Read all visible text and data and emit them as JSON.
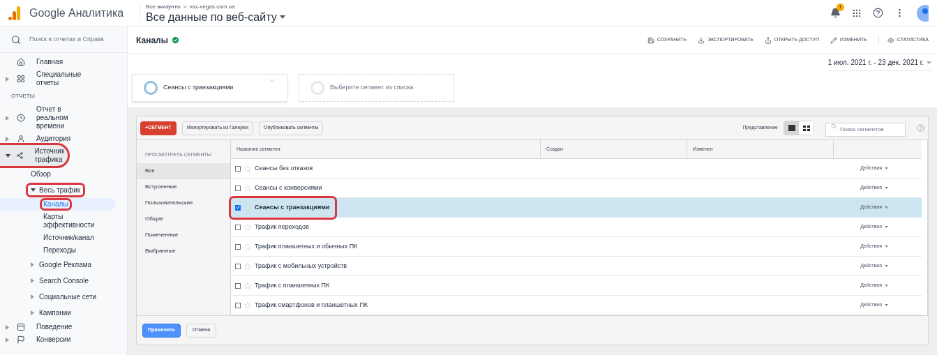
{
  "header": {
    "product": "Google Аналитика",
    "breadcrumb": [
      "Все аккаунты",
      ">",
      "vaz-vegas.com.ua"
    ],
    "view_title": "Все данные по веб-сайту",
    "notifications": "1"
  },
  "sidebar": {
    "search_placeholder": "Поиск в отчетах и Справк",
    "items": [
      {
        "kind": "item",
        "label": "Главная",
        "expandable": false,
        "expanded": false,
        "highlighted": false
      },
      {
        "kind": "item",
        "label": "Специальные отчеты",
        "expandable": true,
        "expanded": false,
        "highlighted": false
      },
      {
        "kind": "section",
        "label": "ОТЧЕТЫ"
      },
      {
        "kind": "item",
        "label": "Отчет в реальном времени",
        "expandable": true,
        "expanded": false,
        "highlighted": false
      },
      {
        "kind": "item",
        "label": "Аудитория",
        "expandable": true,
        "expanded": false,
        "highlighted": false
      },
      {
        "kind": "item",
        "label": "Источник трафика",
        "expandable": true,
        "expanded": true,
        "highlighted": true,
        "children": [
          {
            "label": "Обзор",
            "expandable": false,
            "expanded": false,
            "highlighted": false
          },
          {
            "label": "Весь трафик",
            "expandable": true,
            "expanded": true,
            "highlighted": true,
            "children": [
              {
                "label": "Каналы",
                "selected": true,
                "highlighted": true
              },
              {
                "label": "Карты эффективности",
                "selected": false,
                "highlighted": false
              },
              {
                "label": "Источник/канал",
                "selected": false,
                "highlighted": false
              },
              {
                "label": "Переходы",
                "selected": false,
                "highlighted": false
              }
            ]
          },
          {
            "label": "Google Реклама",
            "expandable": true,
            "expanded": false,
            "highlighted": false
          },
          {
            "label": "Search Console",
            "expandable": true,
            "expanded": false,
            "highlighted": false
          },
          {
            "label": "Социальные сети",
            "expandable": true,
            "expanded": false,
            "highlighted": false
          },
          {
            "label": "Кампании",
            "expandable": true,
            "expanded": false,
            "highlighted": false
          }
        ]
      },
      {
        "kind": "item",
        "label": "Поведение",
        "expandable": true,
        "expanded": false,
        "highlighted": false
      },
      {
        "kind": "item",
        "label": "Конверсии",
        "expandable": true,
        "expanded": false,
        "highlighted": false
      }
    ]
  },
  "report": {
    "title": "Каналы",
    "actions": [
      "СОХРАНИТЬ",
      "ЭКСПОРТИРОВАТЬ",
      "ОТКРЫТЬ ДОСТУП",
      "ИЗМЕНИТЬ",
      "СТАТИСТИКА"
    ],
    "date_range": "1 июл. 2021 г. - 23 дек. 2021 г."
  },
  "segment_slots": [
    {
      "label": "Сеансы с транзакциями",
      "filled": true
    },
    {
      "label": "Выберите сегмент из списка",
      "filled": false
    }
  ],
  "segment_panel": {
    "new_button": "+СЕГМЕНТ",
    "buttons": [
      "Импортировать из Галереи",
      "Опубликовать сегменты"
    ],
    "view_label": "Представление",
    "view_modes": [
      {
        "selected": true
      },
      {
        "selected": false
      }
    ],
    "search_placeholder": "Поиск сегментов",
    "filter_heading": "ПРОСМОТРЕТЬ СЕГМЕНТЫ",
    "filters": [
      {
        "label": "Все",
        "selected": true
      },
      {
        "label": "Встроенные",
        "selected": false
      },
      {
        "label": "Пользовательские",
        "selected": false
      },
      {
        "label": "Общие",
        "selected": false
      },
      {
        "label": "Помеченные",
        "selected": false
      },
      {
        "label": "Выбранные",
        "selected": false
      }
    ],
    "columns": [
      "Название сегмента",
      "Создан",
      "Изменен"
    ],
    "rows": [
      {
        "name": "Сеансы без отказов",
        "checked": false,
        "starred": false,
        "highlighted": false,
        "action": "Действия"
      },
      {
        "name": "Сеансы с конверсиями",
        "checked": false,
        "starred": false,
        "highlighted": false,
        "action": "Действия"
      },
      {
        "name": "Сеансы с транзакциями",
        "checked": true,
        "starred": false,
        "highlighted": true,
        "action": "Действия"
      },
      {
        "name": "Трафик переходов",
        "checked": false,
        "starred": false,
        "highlighted": false,
        "action": "Действия"
      },
      {
        "name": "Трафик планшетных и обычных ПК",
        "checked": false,
        "starred": false,
        "highlighted": false,
        "action": "Действия"
      },
      {
        "name": "Трафик с мобильных устройств",
        "checked": false,
        "starred": false,
        "highlighted": false,
        "action": "Действия"
      },
      {
        "name": "Трафик с планшетных ПК",
        "checked": false,
        "starred": false,
        "highlighted": false,
        "action": "Действия"
      },
      {
        "name": "Трафик смартфонов и планшетных ПК",
        "checked": false,
        "starred": false,
        "highlighted": false,
        "action": "Действия"
      }
    ],
    "apply_button": "Применить",
    "cancel_button": "Отмена"
  }
}
